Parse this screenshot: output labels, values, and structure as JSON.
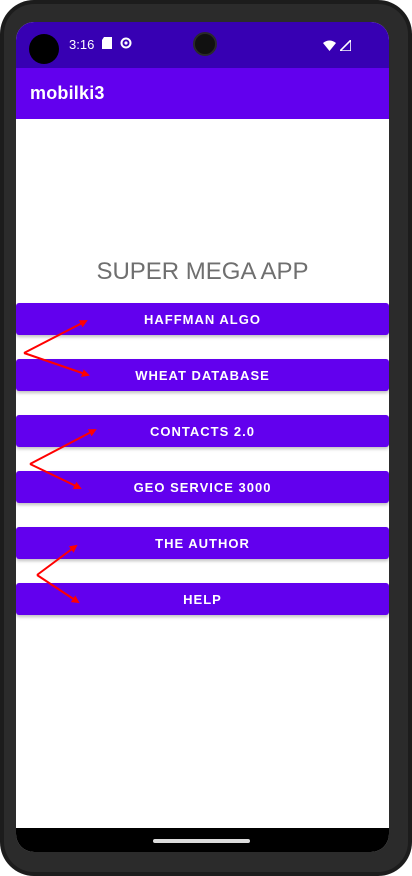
{
  "status_bar": {
    "time": "3:16",
    "icons": [
      "sd-card-icon",
      "settings-icon",
      "wifi-icon",
      "signal-icon"
    ]
  },
  "app_bar": {
    "title": "mobilki3"
  },
  "main": {
    "headline": "SUPER MEGA APP",
    "buttons": [
      {
        "label": "HAFFMAN ALGO"
      },
      {
        "label": "WHEAT DATABASE"
      },
      {
        "label": "CONTACTS 2.0"
      },
      {
        "label": "GEO SERVICE 3000"
      },
      {
        "label": "THE AUTHOR"
      },
      {
        "label": "HELP"
      }
    ]
  },
  "colors": {
    "status_bar": "#3700b3",
    "app_bar": "#6200ee",
    "button": "#6200ee",
    "annotation_arrow": "#ff0000"
  }
}
